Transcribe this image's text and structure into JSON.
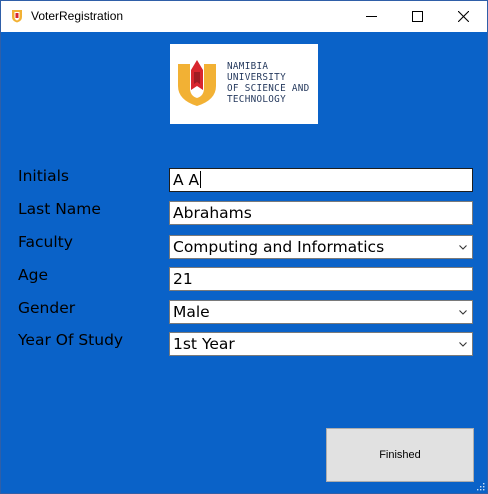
{
  "window": {
    "title": "VoterRegistration"
  },
  "logo": {
    "lines": [
      "NAMIBIA",
      "UNIVERSITY",
      "OF SCIENCE AND",
      "TECHNOLOGY"
    ]
  },
  "form": {
    "initials": {
      "label": "Initials",
      "value": "A A"
    },
    "last_name": {
      "label": "Last Name",
      "value": "Abrahams"
    },
    "faculty": {
      "label": "Faculty",
      "value": "Computing and Informatics"
    },
    "age": {
      "label": "Age",
      "value": "21"
    },
    "gender": {
      "label": "Gender",
      "value": "Male"
    },
    "year_of_study": {
      "label": "Year Of Study",
      "value": "1st Year"
    }
  },
  "actions": {
    "finished_label": "Finished"
  },
  "colors": {
    "window_background": "#0a62c8",
    "logo_gold": "#f2b134",
    "logo_red": "#d8262e"
  },
  "icons": [
    "app-shield-icon",
    "minimize-icon",
    "maximize-icon",
    "close-icon",
    "chevron-down-icon",
    "resize-grip-icon"
  ]
}
